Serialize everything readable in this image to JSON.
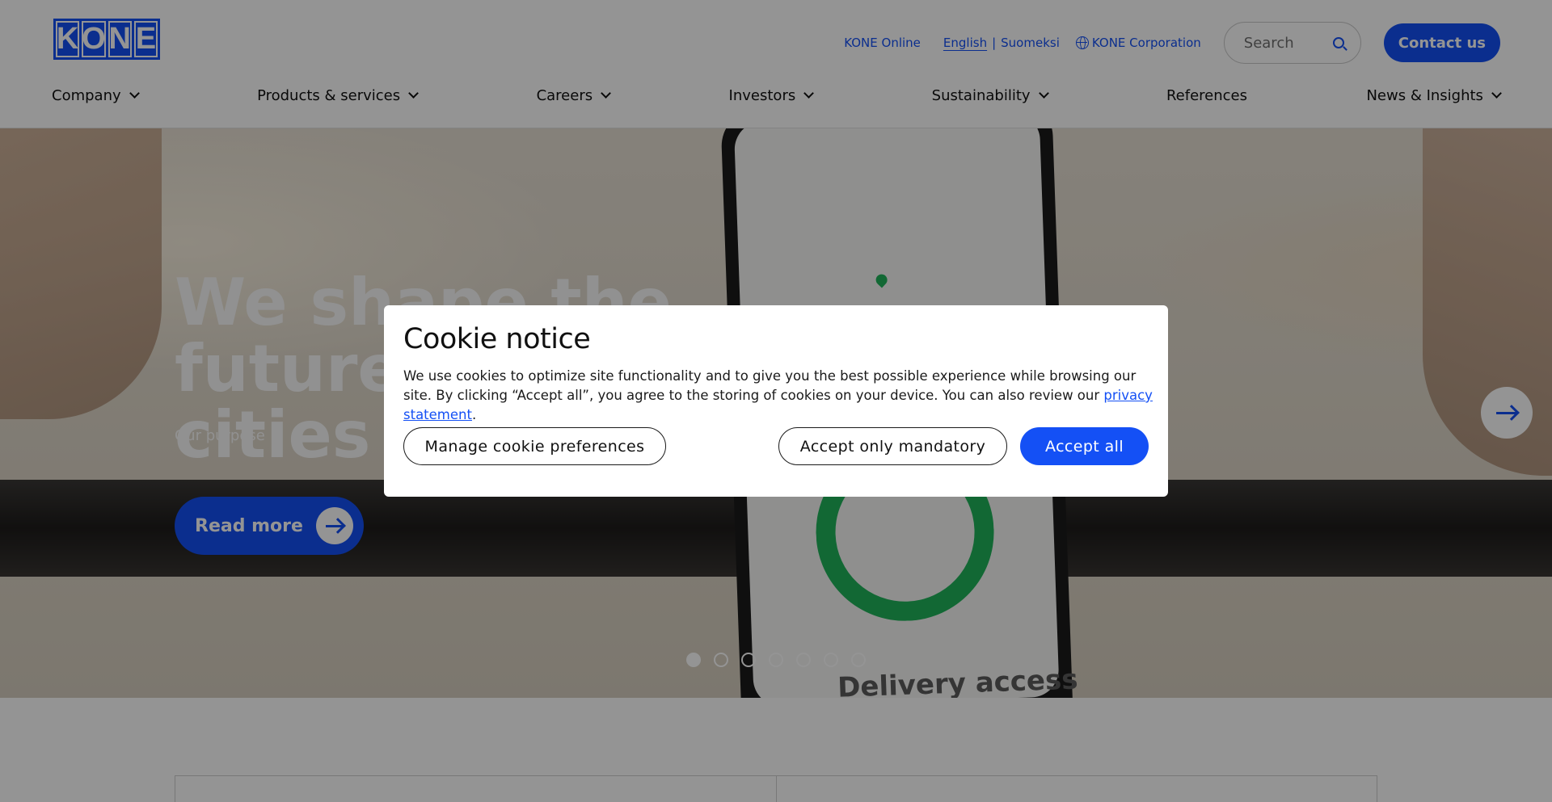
{
  "header": {
    "logo_letters": [
      "K",
      "O",
      "N",
      "E"
    ],
    "kone_online": "KONE Online",
    "languages": {
      "active": "English",
      "separator": "|",
      "other": "Suomeksi"
    },
    "corporation": "KONE Corporation",
    "search_placeholder": "Search",
    "contact": "Contact us"
  },
  "nav": [
    {
      "label": "Company",
      "has_menu": true
    },
    {
      "label": "Products & services",
      "has_menu": true
    },
    {
      "label": "Careers",
      "has_menu": true
    },
    {
      "label": "Investors",
      "has_menu": true
    },
    {
      "label": "Sustainability",
      "has_menu": true
    },
    {
      "label": "References",
      "has_menu": false
    },
    {
      "label": "News & Insights",
      "has_menu": true
    }
  ],
  "hero": {
    "title_line1": "We shape the future of",
    "title_line2": "cities",
    "subtitle": "Our purpose",
    "cta": "Read more",
    "phone_label": "Delivery access",
    "slides_total": 7,
    "active_slide": 1
  },
  "cookie": {
    "title": "Cookie notice",
    "body": "We use cookies to optimize site functionality and to give you the best possible experience while browsing our site. By clicking “Accept all”, you agree to the storing of cookies on your device. You can also review our ",
    "link": "privacy statement",
    "body_end": ".",
    "manage": "Manage cookie preferences",
    "mandatory": "Accept only mandatory",
    "accept_all": "Accept all"
  },
  "colors": {
    "brand": "#1450f5",
    "overlay": "rgba(0,0,0,0.42)",
    "accent_green": "#1fb35a"
  }
}
